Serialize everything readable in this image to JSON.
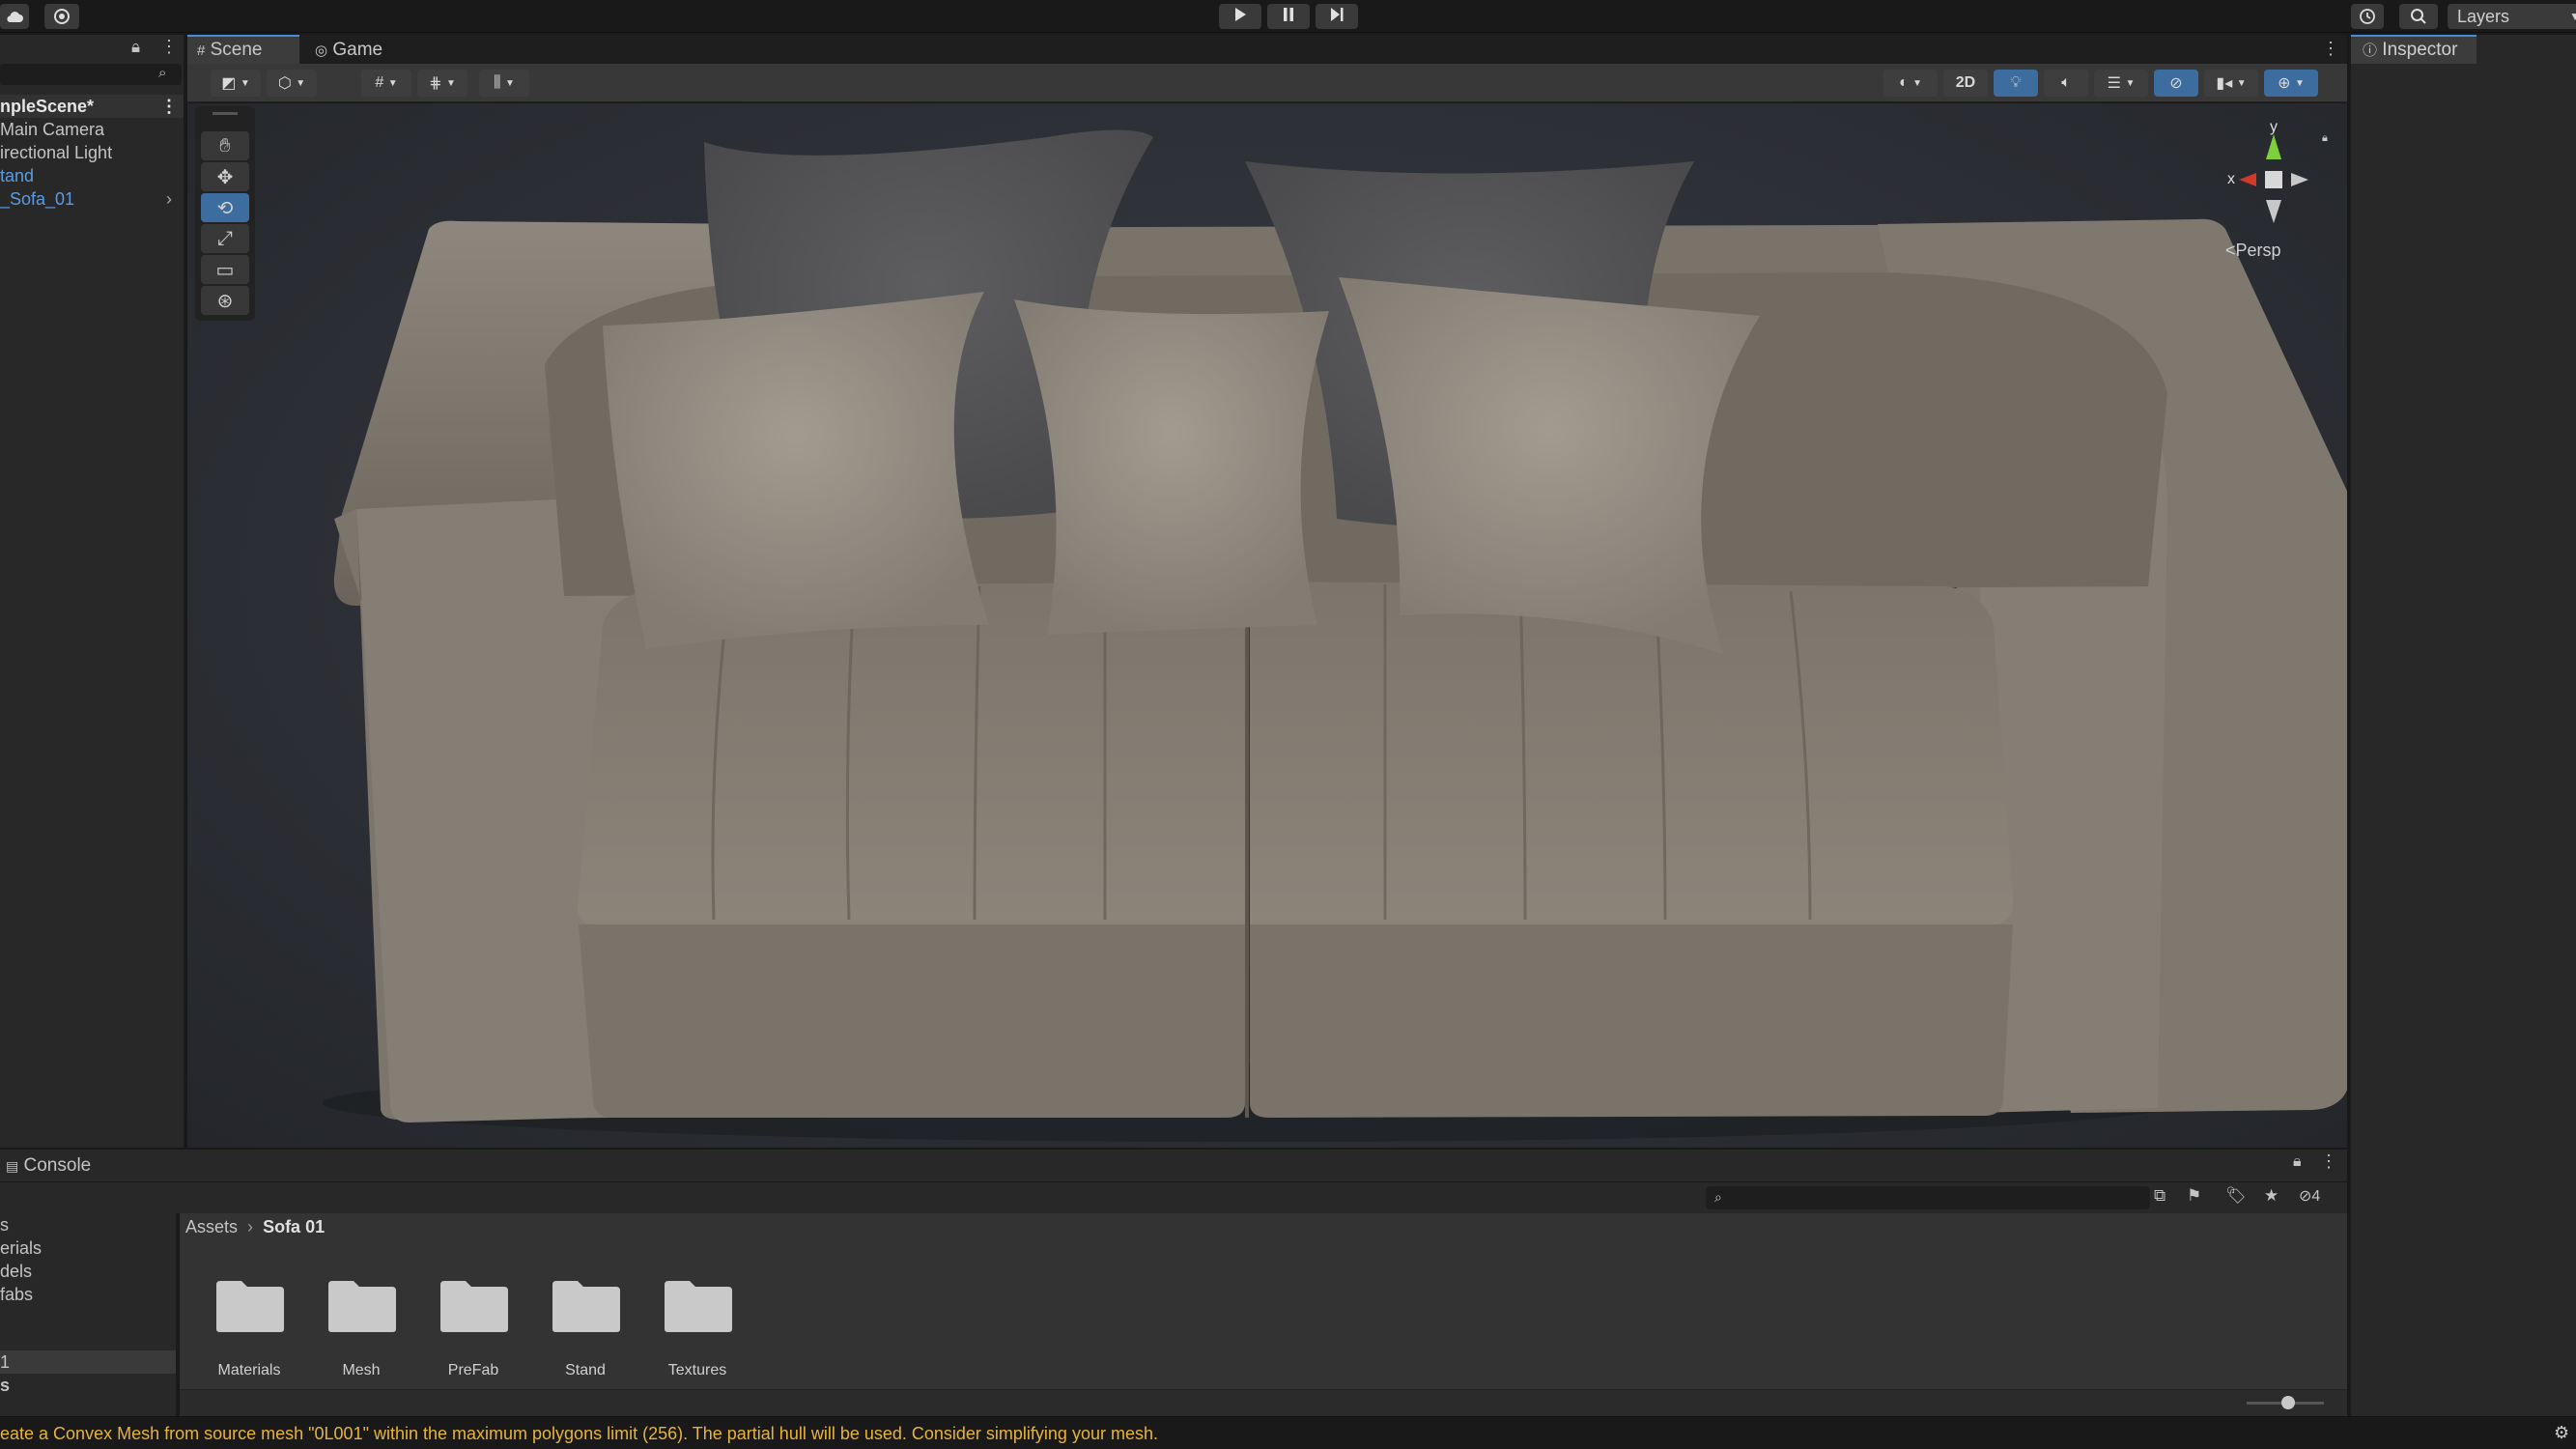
{
  "colors": {
    "accent": "#4a8bd6",
    "warning_text": "#e8b33a",
    "toggle_on": "#3d6c9e"
  },
  "topbar": {
    "cloud_icon": "cloud-icon",
    "collab_icon": "collab-icon",
    "play_icon": "play-icon",
    "pause_icon": "pause-icon",
    "step_icon": "step-icon",
    "history_icon": "history-icon",
    "search_icon": "search-icon",
    "layers_label": "Layers"
  },
  "hierarchy": {
    "items": [
      {
        "label": "npleScene*"
      },
      {
        "label": "Main Camera"
      },
      {
        "label": "irectional Light"
      },
      {
        "label": "tand"
      },
      {
        "label": "_Sofa_01"
      }
    ]
  },
  "scene": {
    "tabs": [
      {
        "label": "Scene"
      },
      {
        "label": "Game"
      }
    ],
    "toggle_2d": "2D",
    "gizmo": {
      "y_label": "y",
      "x_label": "x",
      "persp_label": "Persp"
    }
  },
  "inspector": {
    "tab_label": "Inspector"
  },
  "console": {
    "tab_label": "Console",
    "hidden_count": "4"
  },
  "project": {
    "breadcrumb": [
      "Assets",
      "Sofa 01"
    ],
    "left_items": [
      {
        "label": "s"
      },
      {
        "label": "erials"
      },
      {
        "label": "dels"
      },
      {
        "label": "fabs"
      },
      {
        "label": "1"
      },
      {
        "label": "s"
      }
    ],
    "folders": [
      {
        "label": "Materials"
      },
      {
        "label": "Mesh"
      },
      {
        "label": "PreFab"
      },
      {
        "label": "Stand"
      },
      {
        "label": "Textures"
      }
    ]
  },
  "status": {
    "message": "eate a Convex Mesh from source mesh \"0L001\" within the maximum polygons limit (256). The partial hull will be used. Consider simplifying your mesh."
  }
}
